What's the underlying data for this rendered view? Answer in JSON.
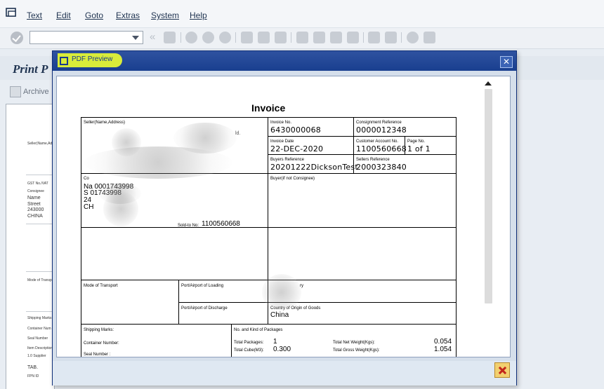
{
  "menu": {
    "items": [
      "Text",
      "Edit",
      "Goto",
      "Extras",
      "System",
      "Help"
    ]
  },
  "toolbar": {
    "command_field_value": "",
    "icons": [
      "enter-icon",
      "save-icon",
      "back-icon",
      "exit-icon",
      "cancel-icon",
      "print-icon",
      "find-icon",
      "find-next-icon",
      "first-page-icon",
      "prev-page-icon",
      "next-page-icon",
      "last-page-icon",
      "new-session-icon",
      "shortcut-icon",
      "help-icon",
      "layout-icon"
    ]
  },
  "background": {
    "title": "Print P",
    "archive_label": "Archive",
    "doc_lines": [
      "Seller(Name,Addr",
      "GST No./VAT",
      "Consignee",
      "Name",
      "Street",
      "243000",
      "CHINA",
      "Mode of Transp",
      "Shipping Marks",
      "Container Num",
      "Seal Number",
      "Item Description",
      "1.0 Supplier",
      "TAB.",
      "FPN ID"
    ]
  },
  "popup": {
    "title": "PDF Preview"
  },
  "invoice": {
    "title": "Invoice",
    "seller_label": "Seller(Name,Address)",
    "invoice_no_label": "Invoice No.",
    "invoice_no": "6430000068",
    "consignment_ref_label": "Consignment Reference",
    "consignment_ref": "0000012348",
    "invoice_date_label": "Invoice Date",
    "invoice_date": "22-DEC-2020",
    "customer_account_label": "Customer Account No.",
    "customer_account": "1100560668",
    "page_no_label": "Page No.",
    "page_no": "1 of 1",
    "buyers_ref_label": "Buyers Reference",
    "buyers_ref": "20201222DicksonTest",
    "sellers_ref_label": "Sellers Reference",
    "sellers_ref": "2000323840",
    "consignee_label": "Co",
    "consignee_lines": [
      "Na      0001743998",
      "S        01743998",
      "24",
      "CH"
    ],
    "buyer_label": "Buyer(if not Consignee)",
    "sold_to_label": "Sold-to No:",
    "sold_to": "1100560668",
    "mode_transport_label": "Mode of Transport",
    "port_loading_label": "Port/Airport of Loading",
    "country_label_fragment": "ry",
    "port_discharge_label": "Port/Airport of Discharge",
    "country_origin_label": "Country of Origin of Goods",
    "country_origin": "China",
    "shipping_marks_label": "Shipping Marks:",
    "container_number_label": "Container Number:",
    "seal_number_label": "Seal Number :",
    "packages_label": "No. and Kind of Packages",
    "total_packages_label": "Total Packages:",
    "total_packages": "1",
    "total_cube_label": "Total Cube(M3):",
    "total_cube": "0.300",
    "net_weight_label": "Total Net Weight(Kgs):",
    "net_weight": "0.054",
    "gross_weight_label": "Total Gross Weight(Kgs):",
    "gross_weight": "1.054",
    "seller_fragment": "ld."
  }
}
